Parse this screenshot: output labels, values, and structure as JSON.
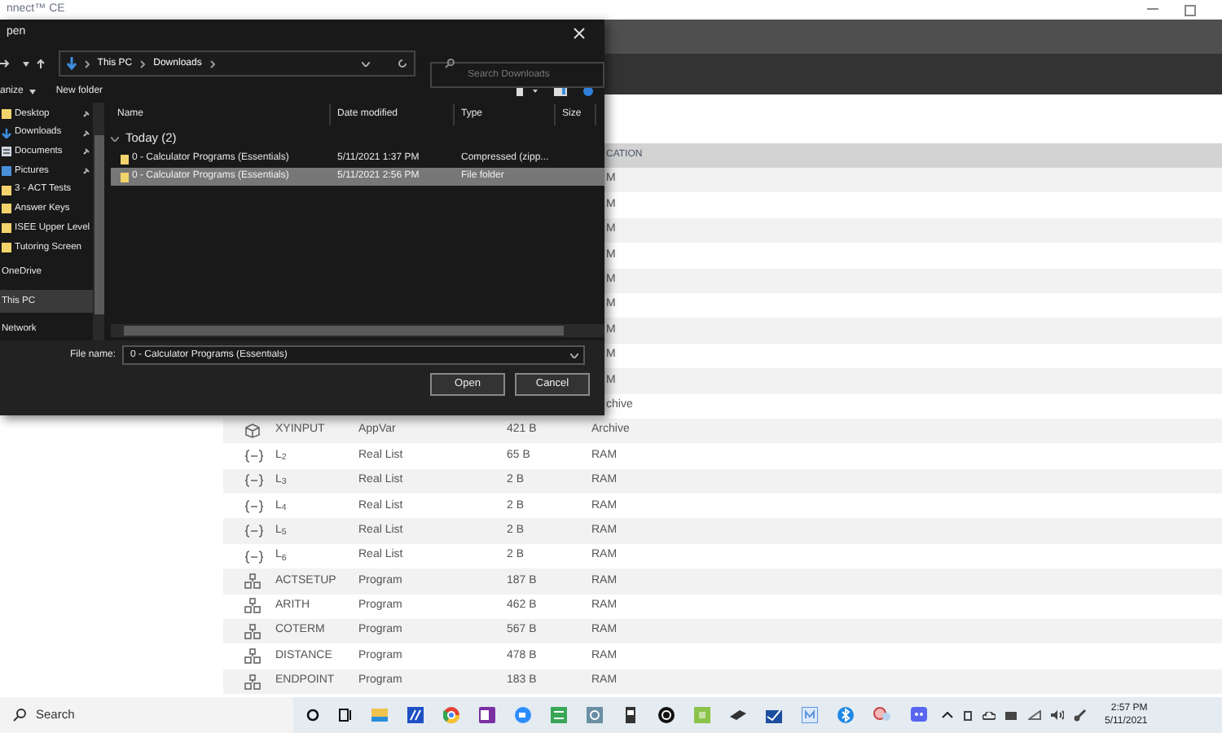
{
  "app": {
    "title": "nnect™ CE"
  },
  "table": {
    "location_header": "CATION",
    "covered_rows": [
      {
        "location": "M"
      },
      {
        "location": "M"
      },
      {
        "location": "M"
      },
      {
        "location": "M"
      },
      {
        "location": "M"
      },
      {
        "location": "M"
      },
      {
        "location": "M"
      },
      {
        "location": "M"
      },
      {
        "location": "M"
      },
      {
        "location": "chive"
      }
    ],
    "rows": [
      {
        "kind": "appvar",
        "name": "XYINPUT",
        "type": "AppVar",
        "size": "421 B",
        "location": "Archive"
      },
      {
        "kind": "list",
        "name": "L$_{2}$",
        "type": "Real List",
        "size": "65 B",
        "location": "RAM"
      },
      {
        "kind": "list",
        "name": "L$_{3}$",
        "type": "Real List",
        "size": "2 B",
        "location": "RAM"
      },
      {
        "kind": "list",
        "name": "L$_{4}$",
        "type": "Real List",
        "size": "2 B",
        "location": "RAM"
      },
      {
        "kind": "list",
        "name": "L$_{5}$",
        "type": "Real List",
        "size": "2 B",
        "location": "RAM"
      },
      {
        "kind": "list",
        "name": "L$_{6}$",
        "type": "Real List",
        "size": "2 B",
        "location": "RAM"
      },
      {
        "kind": "program",
        "name": "ACTSETUP",
        "type": "Program",
        "size": "187 B",
        "location": "RAM"
      },
      {
        "kind": "program",
        "name": "ARITH",
        "type": "Program",
        "size": "462 B",
        "location": "RAM"
      },
      {
        "kind": "program",
        "name": "COTERM",
        "type": "Program",
        "size": "567 B",
        "location": "RAM"
      },
      {
        "kind": "program",
        "name": "DISTANCE",
        "type": "Program",
        "size": "478 B",
        "location": "RAM"
      },
      {
        "kind": "program",
        "name": "ENDPOINT",
        "type": "Program",
        "size": "183 B",
        "location": "RAM"
      }
    ]
  },
  "dialog": {
    "title": "pen",
    "breadcrumb": [
      "This PC",
      "Downloads"
    ],
    "search": {
      "placeholder": "Search Downloads"
    },
    "toolbar": {
      "organize": "anize",
      "new_folder": "New folder"
    },
    "nav": [
      {
        "kind": "folder",
        "label": "Desktop",
        "pinned": true,
        "selected": false
      },
      {
        "kind": "download",
        "label": "Downloads",
        "pinned": true,
        "selected": false
      },
      {
        "kind": "doc",
        "label": "Documents",
        "pinned": true,
        "selected": false
      },
      {
        "kind": "pic",
        "label": "Pictures",
        "pinned": true,
        "selected": false
      },
      {
        "kind": "folder",
        "label": "3 - ACT Tests",
        "pinned": false,
        "selected": false
      },
      {
        "kind": "folder",
        "label": "Answer Keys",
        "pinned": false,
        "selected": false
      },
      {
        "kind": "folder",
        "label": "ISEE Upper Level",
        "pinned": false,
        "selected": false
      },
      {
        "kind": "folder",
        "label": "Tutoring Screen",
        "pinned": false,
        "selected": false
      },
      {
        "kind": "plain",
        "label": "OneDrive",
        "pinned": false,
        "selected": false
      },
      {
        "kind": "plain",
        "label": "This PC",
        "pinned": false,
        "selected": true
      },
      {
        "kind": "plain",
        "label": "Network",
        "pinned": false,
        "selected": false
      }
    ],
    "columns": [
      "Name",
      "Date modified",
      "Type",
      "Size"
    ],
    "group": "Today (2)",
    "files": [
      {
        "name": "0 - Calculator Programs (Essentials)",
        "date": "5/11/2021 1:37 PM",
        "type": "Compressed (zipp...",
        "selected": false
      },
      {
        "name": "0 - Calculator Programs (Essentials)",
        "date": "5/11/2021 2:56 PM",
        "type": "File folder",
        "selected": true
      }
    ],
    "file_name_label": "File name:",
    "file_name": "0 - Calculator Programs (Essentials)",
    "buttons": [
      "Open",
      "Cancel"
    ]
  },
  "taskbar": {
    "search": "Search",
    "time": "2:57 PM",
    "date": "5/11/2021"
  }
}
